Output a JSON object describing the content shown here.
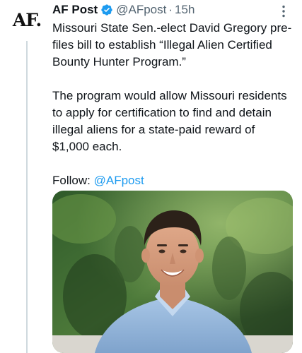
{
  "tweet": {
    "avatar_text": "AF.",
    "display_name": "AF Post",
    "handle": "@AFpost",
    "separator": "·",
    "time": "15h",
    "paragraphs": [
      "Missouri State Sen.-elect David Gregory pre-files bill to establish “Illegal Alien Certified Bounty Hunter Program.”",
      "The program would allow Missouri residents to apply for certification to find and detain illegal aliens for a state-paid reward of $1,000 each."
    ],
    "follow_label": "Follow:",
    "follow_mention": "@AFpost",
    "media": {
      "icon": "photo-of-smiling-man-in-blue-shirt"
    }
  },
  "icons": {
    "verified": "verified-badge-icon",
    "more": "more-options-icon"
  },
  "colors": {
    "text": "#0f1419",
    "secondary": "#536471",
    "link": "#1d9bf0",
    "verified": "#1d9bf0",
    "thread_line": "#cfd9de"
  }
}
